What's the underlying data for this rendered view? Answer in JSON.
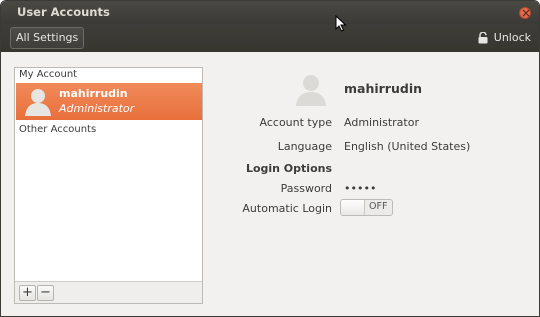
{
  "window": {
    "title": "User Accounts"
  },
  "toolbar": {
    "all_settings_label": "All Settings",
    "unlock_label": "Unlock"
  },
  "accounts": {
    "my_account_header": "My Account",
    "selected_user": {
      "name": "mahirrudin",
      "role": "Administrator"
    },
    "other_accounts_header": "Other Accounts",
    "add_label": "+",
    "remove_label": "−"
  },
  "details": {
    "username": "mahirrudin",
    "account_type_label": "Account type",
    "account_type_value": "Administrator",
    "language_label": "Language",
    "language_value": "English (United States)",
    "login_options_heading": "Login Options",
    "password_label": "Password",
    "password_value": "•••••",
    "automatic_login_label": "Automatic Login",
    "automatic_login_state": "OFF"
  },
  "colors": {
    "selection": "#e9703d",
    "titlebar": "#3b3a36",
    "close": "#e26a4c"
  },
  "icons": [
    "close-icon",
    "lock-icon",
    "user-avatar-icon",
    "mouse-pointer-icon"
  ]
}
